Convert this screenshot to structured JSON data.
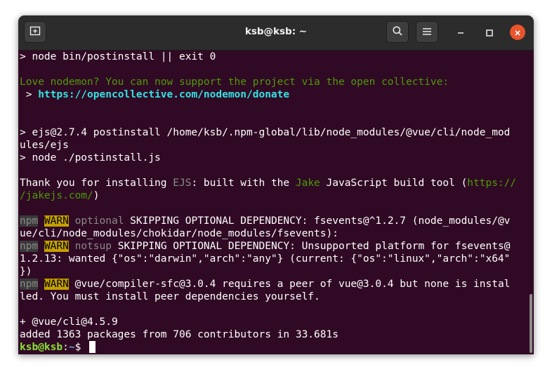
{
  "window": {
    "title": "ksb@ksb: ~",
    "icons": {
      "new_tab": "new-tab-icon",
      "search": "search-icon",
      "menu": "hamburger-menu-icon",
      "minimize": "minimize-icon",
      "maximize": "maximize-icon",
      "close": "close-icon"
    },
    "close_color": "#e9542c"
  },
  "terminal": {
    "background": "#300a24",
    "lines": [
      [
        {
          "t": "> node bin/postinstall || exit 0"
        }
      ],
      [],
      [
        {
          "t": "Love nodemon? You can now support the project via the open collective:",
          "c": "green"
        }
      ],
      [
        {
          "t": " > "
        },
        {
          "t": "https://opencollective.com/nodemon/donate",
          "c": "cyan"
        }
      ],
      [],
      [],
      [
        {
          "t": "> ejs@2.7.4 postinstall /home/ksb/.npm-global/lib/node_modules/@vue/cli/node_mod"
        }
      ],
      [
        {
          "t": "ules/ejs"
        }
      ],
      [
        {
          "t": "> node ./postinstall.js"
        }
      ],
      [],
      [
        {
          "t": "Thank you for installing "
        },
        {
          "t": "EJS",
          "c": "grey"
        },
        {
          "t": ": built with the "
        },
        {
          "t": "Jake",
          "c": "green"
        },
        {
          "t": " JavaScript build tool ("
        },
        {
          "t": "https://",
          "c": "green"
        }
      ],
      [
        {
          "t": "/jakejs.com/",
          "c": "green"
        },
        {
          "t": ")"
        }
      ],
      [],
      [
        {
          "t": "npm",
          "c": "npm"
        },
        {
          "t": " "
        },
        {
          "t": "WARN",
          "c": "warn"
        },
        {
          "t": " "
        },
        {
          "t": "optional",
          "c": "grey"
        },
        {
          "t": " SKIPPING OPTIONAL DEPENDENCY: fsevents@^1.2.7 (node_modules/@v"
        }
      ],
      [
        {
          "t": "ue/cli/node_modules/chokidar/node_modules/fsevents):"
        }
      ],
      [
        {
          "t": "npm",
          "c": "npm"
        },
        {
          "t": " "
        },
        {
          "t": "WARN",
          "c": "warn"
        },
        {
          "t": " "
        },
        {
          "t": "notsup",
          "c": "grey"
        },
        {
          "t": " SKIPPING OPTIONAL DEPENDENCY: Unsupported platform for fsevents@"
        }
      ],
      [
        {
          "t": "1.2.13: wanted {\"os\":\"darwin\",\"arch\":\"any\"} (current: {\"os\":\"linux\",\"arch\":\"x64\""
        }
      ],
      [
        {
          "t": "})"
        }
      ],
      [
        {
          "t": "npm",
          "c": "npm"
        },
        {
          "t": " "
        },
        {
          "t": "WARN",
          "c": "warn"
        },
        {
          "t": " @vue/compiler-sfc@3.0.4 requires a peer of vue@3.0.4 but none is instal"
        }
      ],
      [
        {
          "t": "led. You must install peer dependencies yourself."
        }
      ],
      [],
      [
        {
          "t": "+ @vue/cli@4.5.9"
        }
      ],
      [
        {
          "t": "added 1363 packages from 706 contributors in 33.681s"
        }
      ],
      [
        {
          "t": "ksb@ksb",
          "c": "user"
        },
        {
          "t": ":"
        },
        {
          "t": "~",
          "c": "path"
        },
        {
          "t": "$ "
        }
      ]
    ],
    "colors": {
      "green": "#4e9a06",
      "cyan": "#34e2e2",
      "grey": "#8a8a8a",
      "warn_bg": "#c4a000",
      "user": "#8ae234",
      "path": "#729fcf"
    }
  }
}
